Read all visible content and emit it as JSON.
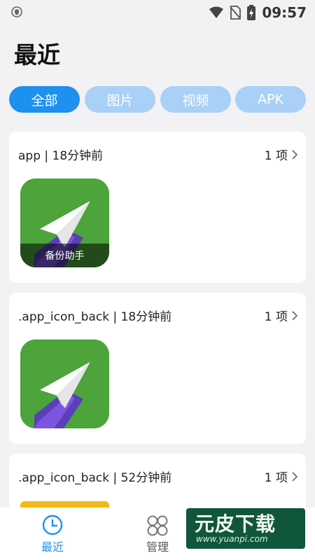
{
  "status_bar": {
    "time": "09:57"
  },
  "page": {
    "title": "最近"
  },
  "filters": [
    {
      "label": "全部",
      "active": true
    },
    {
      "label": "图片",
      "active": false
    },
    {
      "label": "视频",
      "active": false
    },
    {
      "label": "APK",
      "active": false
    }
  ],
  "groups": [
    {
      "title": "app | 18分钟前",
      "count": "1 项",
      "thumb_label": "备份助手"
    },
    {
      "title": ".app_icon_back | 18分钟前",
      "count": "1 项"
    },
    {
      "title": ".app_icon_back | 52分钟前",
      "count": "1 项"
    }
  ],
  "tabs": [
    {
      "label": "最近",
      "active": true
    },
    {
      "label": "管理",
      "active": false
    }
  ],
  "watermark": {
    "text": "元皮下载",
    "url": "www.yuanpi.com"
  },
  "colors": {
    "accent": "#1e90ef",
    "chip_inactive": "#a9d0f6",
    "background": "#f2f2f4",
    "icon_green": "#4ca43a"
  }
}
